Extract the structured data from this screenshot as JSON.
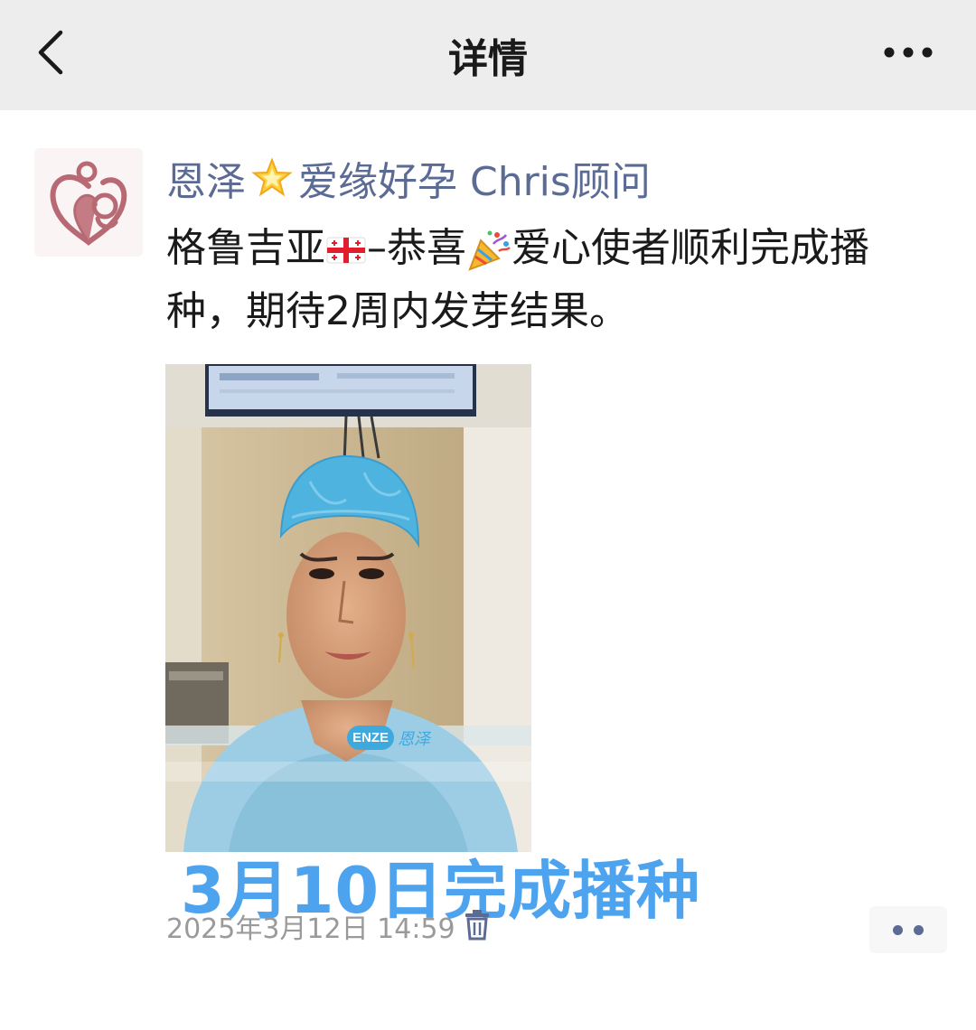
{
  "header": {
    "title": "详情",
    "back_icon": "chevron-left-icon",
    "more_icon": "more-horizontal-icon"
  },
  "post": {
    "author_part1": "恩泽",
    "author_part2": "爱缘好孕 Chris顾问",
    "text_line1_a": "格鲁吉亚",
    "text_line1_b": "–恭喜",
    "text_line1_c": "爱心使者顺利完成播",
    "text_line2": "种，期待2周内发芽结果。",
    "photo_watermark_badge": "ENZE",
    "photo_watermark_text": "恩泽",
    "caption": "3月10日完成播种",
    "timestamp": "2025年3月12日 14:59"
  },
  "colors": {
    "topbar_bg": "#ededed",
    "author_link": "#5b6b94",
    "caption_blue": "#4da3ee",
    "timestamp_gray": "#9a9a9a"
  }
}
